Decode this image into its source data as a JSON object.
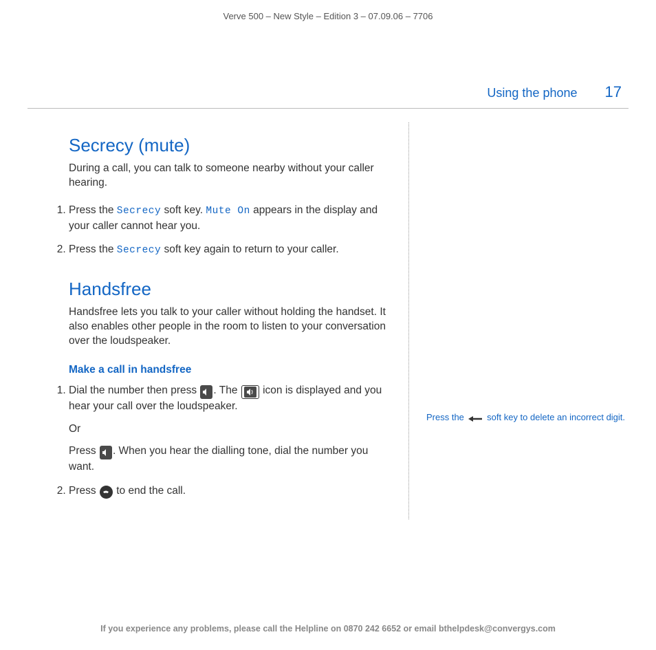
{
  "meta": {
    "topline": "Verve 500 – New Style – Edition 3 – 07.09.06 – 7706"
  },
  "header": {
    "section": "Using the phone",
    "page": "17"
  },
  "secrecy": {
    "title": "Secrecy (mute)",
    "intro": "During a call, you can talk to someone nearby without your caller hearing.",
    "step1_a": "Press the ",
    "step1_lcd1": "Secrecy",
    "step1_b": " soft key. ",
    "step1_lcd2": "Mute On",
    "step1_c": " appears in the display and your caller cannot hear you.",
    "step2_a": "Press the ",
    "step2_lcd": "Secrecy",
    "step2_b": " soft key again to return to your caller."
  },
  "handsfree": {
    "title": "Handsfree",
    "intro": "Handsfree lets you talk to your caller without holding the handset. It also enables other people in the room to listen to your conversation over the loudspeaker.",
    "subhead": "Make a call in handsfree",
    "step1_a": "Dial the number then press ",
    "step1_b": ". The ",
    "step1_c": " icon is displayed and you hear your call over the loudspeaker.",
    "or": "Or",
    "step1_alt_a": "Press ",
    "step1_alt_b": ". When you hear the dialling tone, dial the number you want.",
    "step2_a": "Press ",
    "step2_b": " to end the call."
  },
  "sidebar": {
    "tip_a": "Press the ",
    "tip_b": " soft key to delete an incorrect digit."
  },
  "footer": {
    "text": "If you experience any problems, please call the Helpline on 0870 242 6652 or email bthelpdesk@convergys.com"
  }
}
